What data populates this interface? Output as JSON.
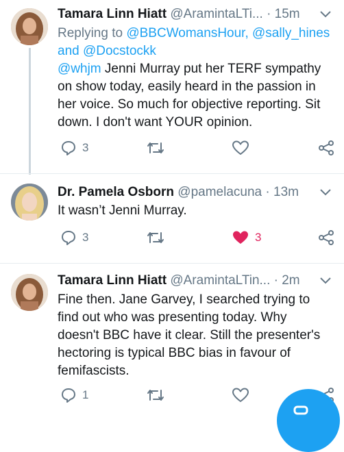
{
  "colors": {
    "link": "#1da1f2",
    "muted": "#657786",
    "like": "#e0245e",
    "fab": "#1da1f2"
  },
  "tweets": [
    {
      "name": "Tamara Linn Hiatt",
      "handle": "@AramintaLTi...",
      "dot": "·",
      "time": "15m",
      "replying_label": "Replying to",
      "reply_users": [
        "@BBCWomansHour",
        "@sally_hines",
        "@Docstockk"
      ],
      "comma": ",",
      "and": "and",
      "mention": "@whjm",
      "text": " Jenni Murray put her TERF sympathy on show today, easily heard in the passion in her voice.  So much for objective reporting.  Sit down.  I don't want YOUR opinion.",
      "replies": "3",
      "retweets": "",
      "likes": "",
      "liked": false,
      "icons": [
        "reply-icon",
        "retweet-icon",
        "heart-outline-icon",
        "share-icon"
      ]
    },
    {
      "name": "Dr. Pamela Osborn",
      "handle": "@pamelacuna",
      "dot": "·",
      "time": "13m",
      "text": "It wasn’t Jenni Murray.",
      "replies": "3",
      "retweets": "",
      "likes": "3",
      "liked": true,
      "icons": [
        "reply-icon",
        "retweet-icon",
        "heart-filled-icon",
        "share-icon"
      ]
    },
    {
      "name": "Tamara Linn Hiatt",
      "handle": "@AramintaLTin...",
      "dot": "·",
      "time": "2m",
      "text": "Fine then.  Jane Garvey, I searched trying to find out who was presenting today. Why doesn't BBC have it clear.   Still the presenter's hectoring is typical BBC bias in favour of femifascists.",
      "replies": "1",
      "retweets": "",
      "likes": "",
      "liked": false,
      "icons": [
        "reply-icon",
        "retweet-icon",
        "heart-outline-icon",
        "share-icon"
      ]
    }
  ]
}
